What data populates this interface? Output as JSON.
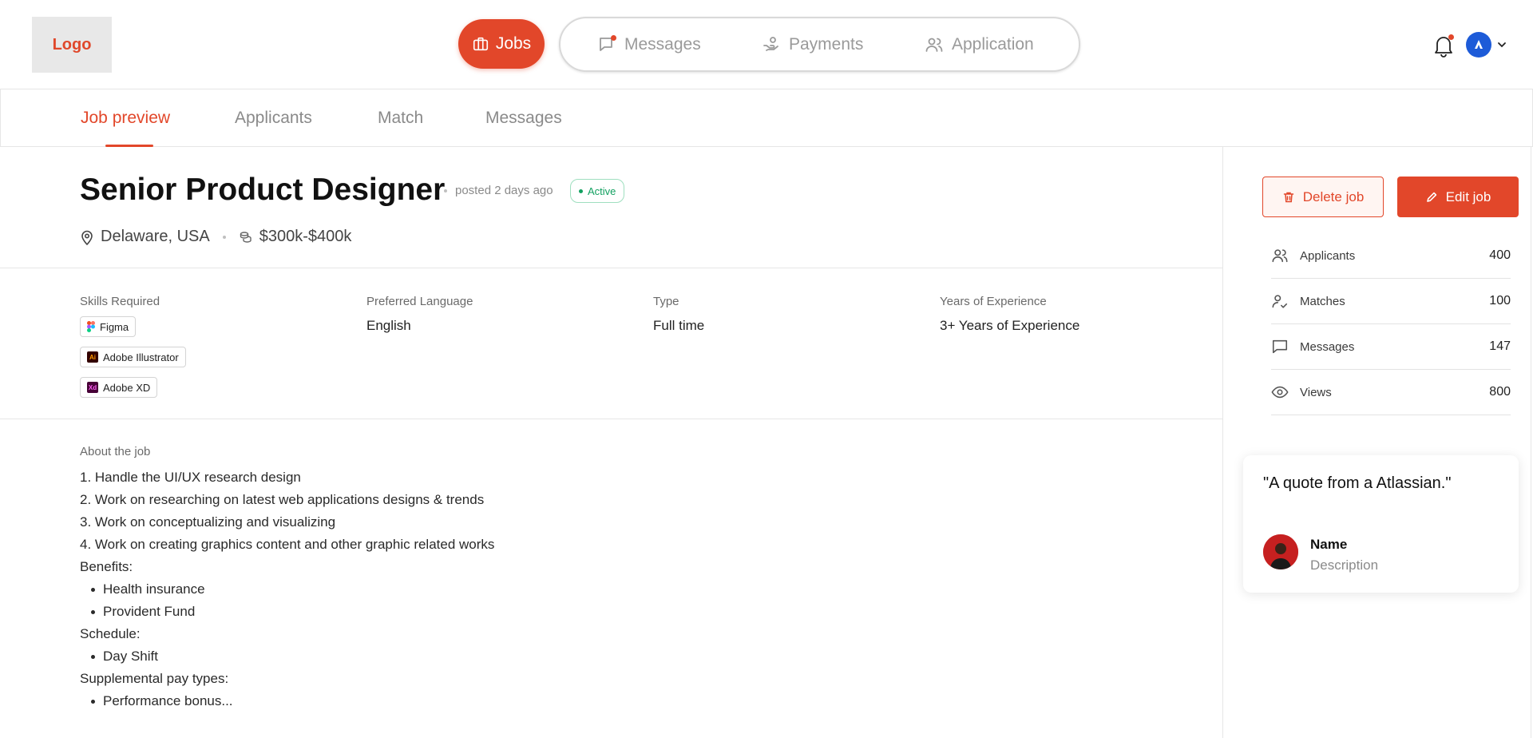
{
  "header": {
    "logo": "Logo",
    "nav": {
      "jobs": "Jobs",
      "messages": "Messages",
      "payments": "Payments",
      "application": "Application"
    },
    "accent_color": "#e2472a"
  },
  "tabs": [
    {
      "label": "Job preview",
      "active": true
    },
    {
      "label": "Applicants",
      "active": false
    },
    {
      "label": "Match",
      "active": false
    },
    {
      "label": "Messages",
      "active": false
    }
  ],
  "job": {
    "title": "Senior Product Designer",
    "posted": "posted 2 days ago",
    "status": "Active",
    "location": "Delaware, USA",
    "salary": "$300k-$400k",
    "details": {
      "skills_label": "Skills Required",
      "skills": [
        "Figma",
        "Adobe Illustrator",
        "Adobe XD"
      ],
      "language_label": "Preferred Language",
      "language": "English",
      "type_label": "Type",
      "type": "Full time",
      "experience_label": "Years of Experience",
      "experience": "3+ Years of Experience"
    },
    "about": {
      "label": "About the job",
      "lines": [
        "1. Handle the UI/UX research design",
        "2. Work on researching on latest web applications designs & trends",
        "3. Work on conceptualizing and visualizing",
        "4. Work on creating graphics content and other graphic related works"
      ],
      "benefits_label": "Benefits:",
      "benefits": [
        "Health insurance",
        "Provident Fund"
      ],
      "schedule_label": "Schedule:",
      "schedule": [
        "Day Shift"
      ],
      "supplemental_label": "Supplemental pay types:",
      "supplemental": [
        "Performance bonus..."
      ]
    }
  },
  "actions": {
    "delete": "Delete job",
    "edit": "Edit job"
  },
  "stats": [
    {
      "label": "Applicants",
      "value": "400",
      "icon": "users-icon"
    },
    {
      "label": "Matches",
      "value": "100",
      "icon": "user-check-icon"
    },
    {
      "label": "Messages",
      "value": "147",
      "icon": "chat-icon"
    },
    {
      "label": "Views",
      "value": "800",
      "icon": "eye-icon"
    }
  ],
  "quote": {
    "text": "\"A quote from a Atlassian.\"",
    "name": "Name",
    "description": "Description"
  }
}
